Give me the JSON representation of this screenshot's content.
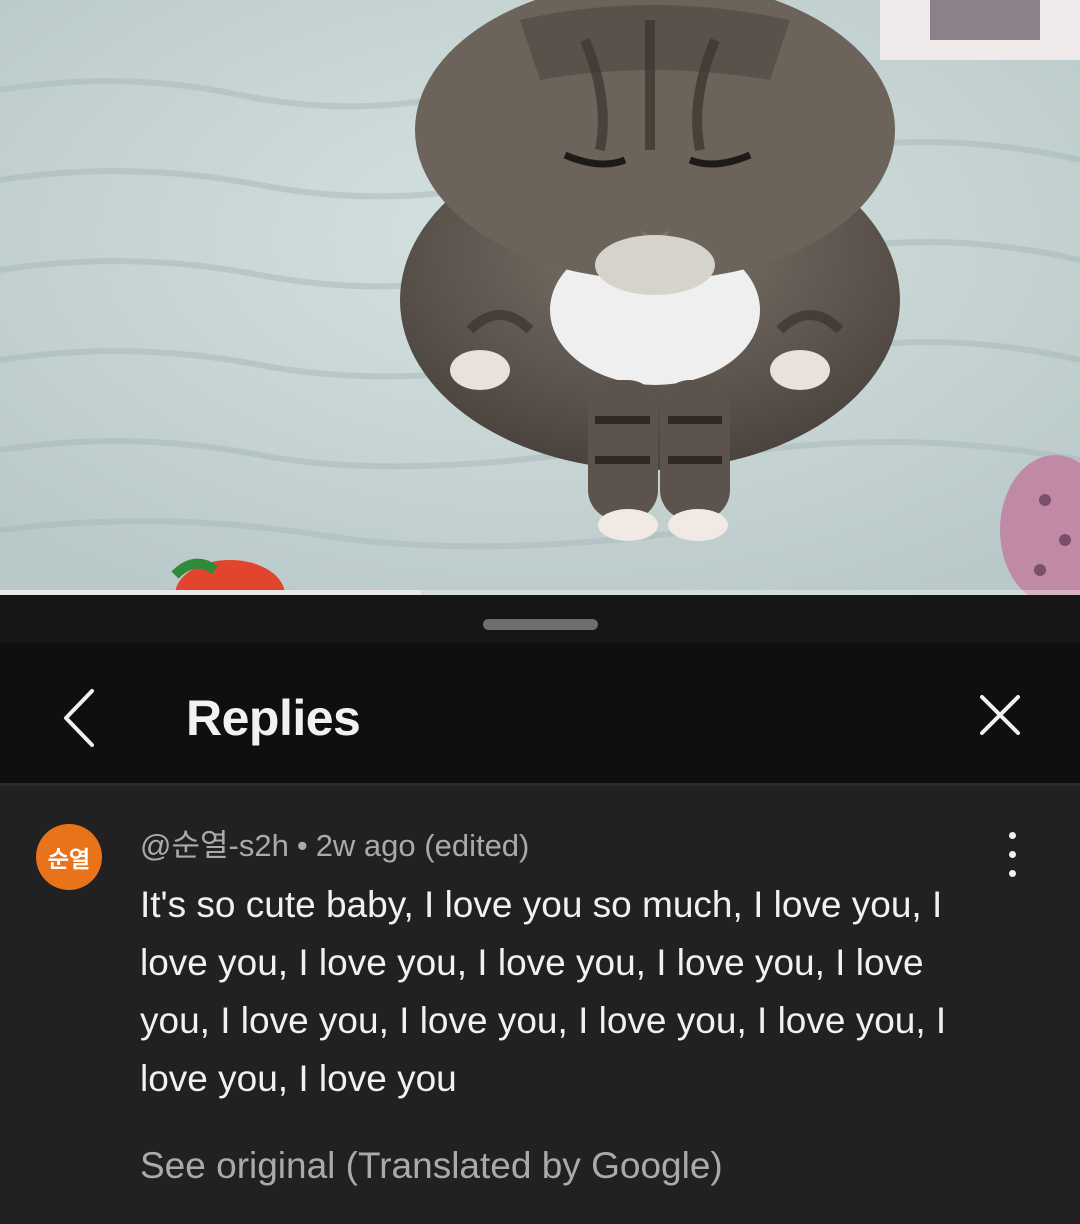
{
  "player": {
    "progress": 0.39,
    "accent_color": "#e8e8e8"
  },
  "sheet": {
    "title": "Replies",
    "back_icon": "chevron-left-icon",
    "close_icon": "close-icon"
  },
  "comment": {
    "avatar_text": "순열",
    "avatar_color": "#e8731a",
    "author": "@순열-s2h",
    "separator": "•",
    "time": "2w ago (edited)",
    "text": "It's so cute baby, I love you so much, I love you, I love you, I love you, I love you, I love you, I love you, I love you, I love you, I love you, I love you, I love you, I love you",
    "translate_link": "See original (Translated by Google)",
    "more_icon": "more-vertical-icon"
  }
}
